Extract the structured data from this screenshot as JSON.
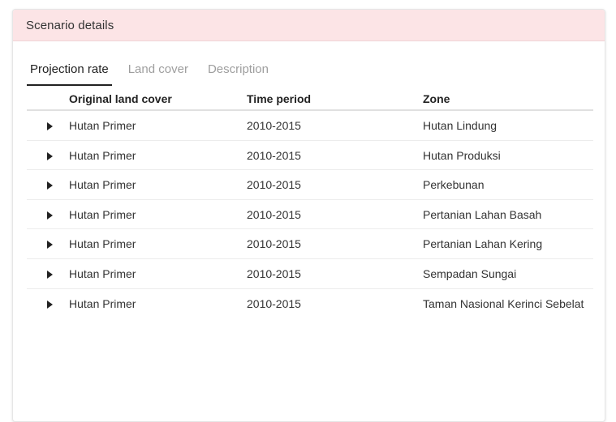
{
  "card": {
    "title": "Scenario details"
  },
  "tabs": [
    {
      "label": "Projection rate",
      "active": true
    },
    {
      "label": "Land cover",
      "active": false
    },
    {
      "label": "Description",
      "active": false
    }
  ],
  "table": {
    "columns": [
      "Original land cover",
      "Time period",
      "Zone"
    ],
    "rows": [
      {
        "original": "Hutan Primer",
        "period": "2010-2015",
        "zone": "Hutan Lindung"
      },
      {
        "original": "Hutan Primer",
        "period": "2010-2015",
        "zone": "Hutan Produksi"
      },
      {
        "original": "Hutan Primer",
        "period": "2010-2015",
        "zone": "Perkebunan"
      },
      {
        "original": "Hutan Primer",
        "period": "2010-2015",
        "zone": "Pertanian Lahan Basah"
      },
      {
        "original": "Hutan Primer",
        "period": "2010-2015",
        "zone": "Pertanian Lahan Kering"
      },
      {
        "original": "Hutan Primer",
        "period": "2010-2015",
        "zone": "Sempadan Sungai"
      },
      {
        "original": "Hutan Primer",
        "period": "2010-2015",
        "zone": "Taman Nasional Kerinci Sebelat"
      }
    ]
  },
  "icons": {
    "expand": "caret-right-icon"
  },
  "colors": {
    "header_bg": "#fce4e6",
    "active_tab": "#222222",
    "inactive_tab": "#9e9e9e"
  }
}
